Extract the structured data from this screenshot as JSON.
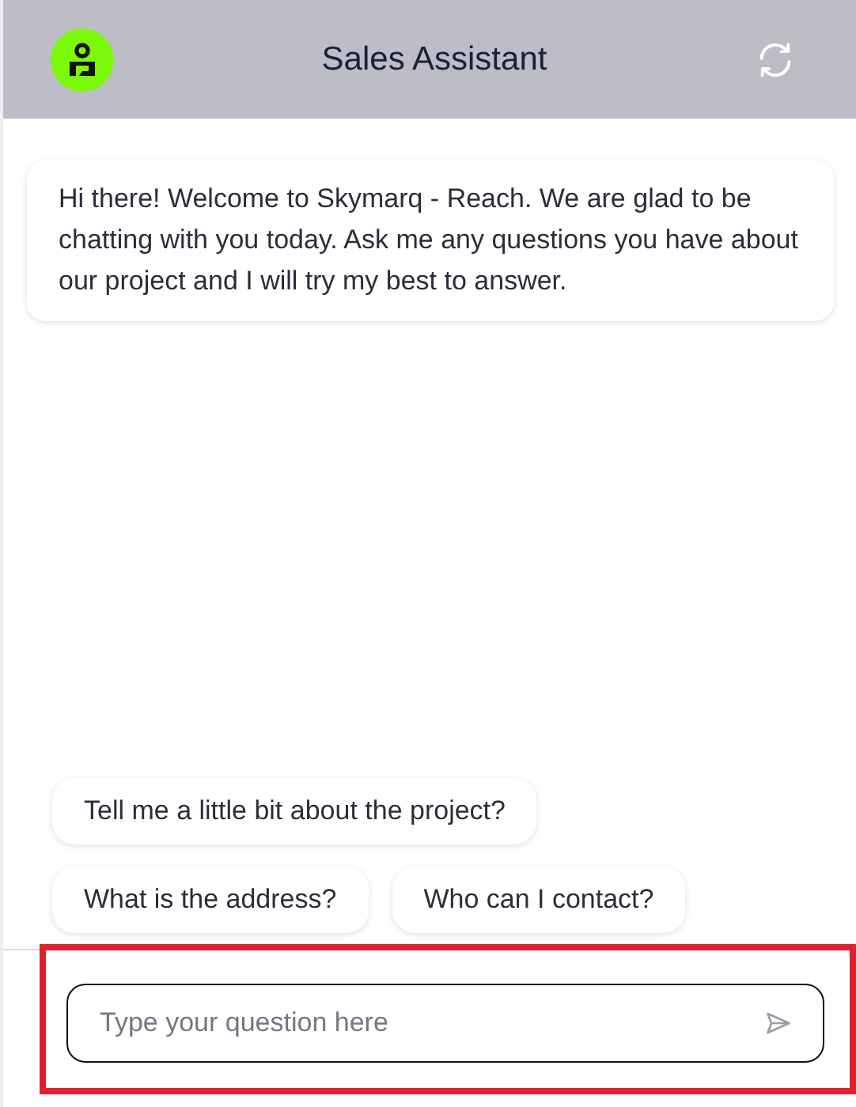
{
  "header": {
    "title": "Sales Assistant"
  },
  "messages": [
    {
      "kind": "bot",
      "text": "Hi there! Welcome to Skymarq - Reach. We are glad to be chatting with you today. Ask me any questions you have about our project and I will try my best to answer."
    }
  ],
  "suggestions": [
    "Tell me a little bit about the project?",
    "What is the address?",
    "Who can I contact?"
  ],
  "composer": {
    "placeholder": "Type your question here",
    "highlighted": true
  }
}
